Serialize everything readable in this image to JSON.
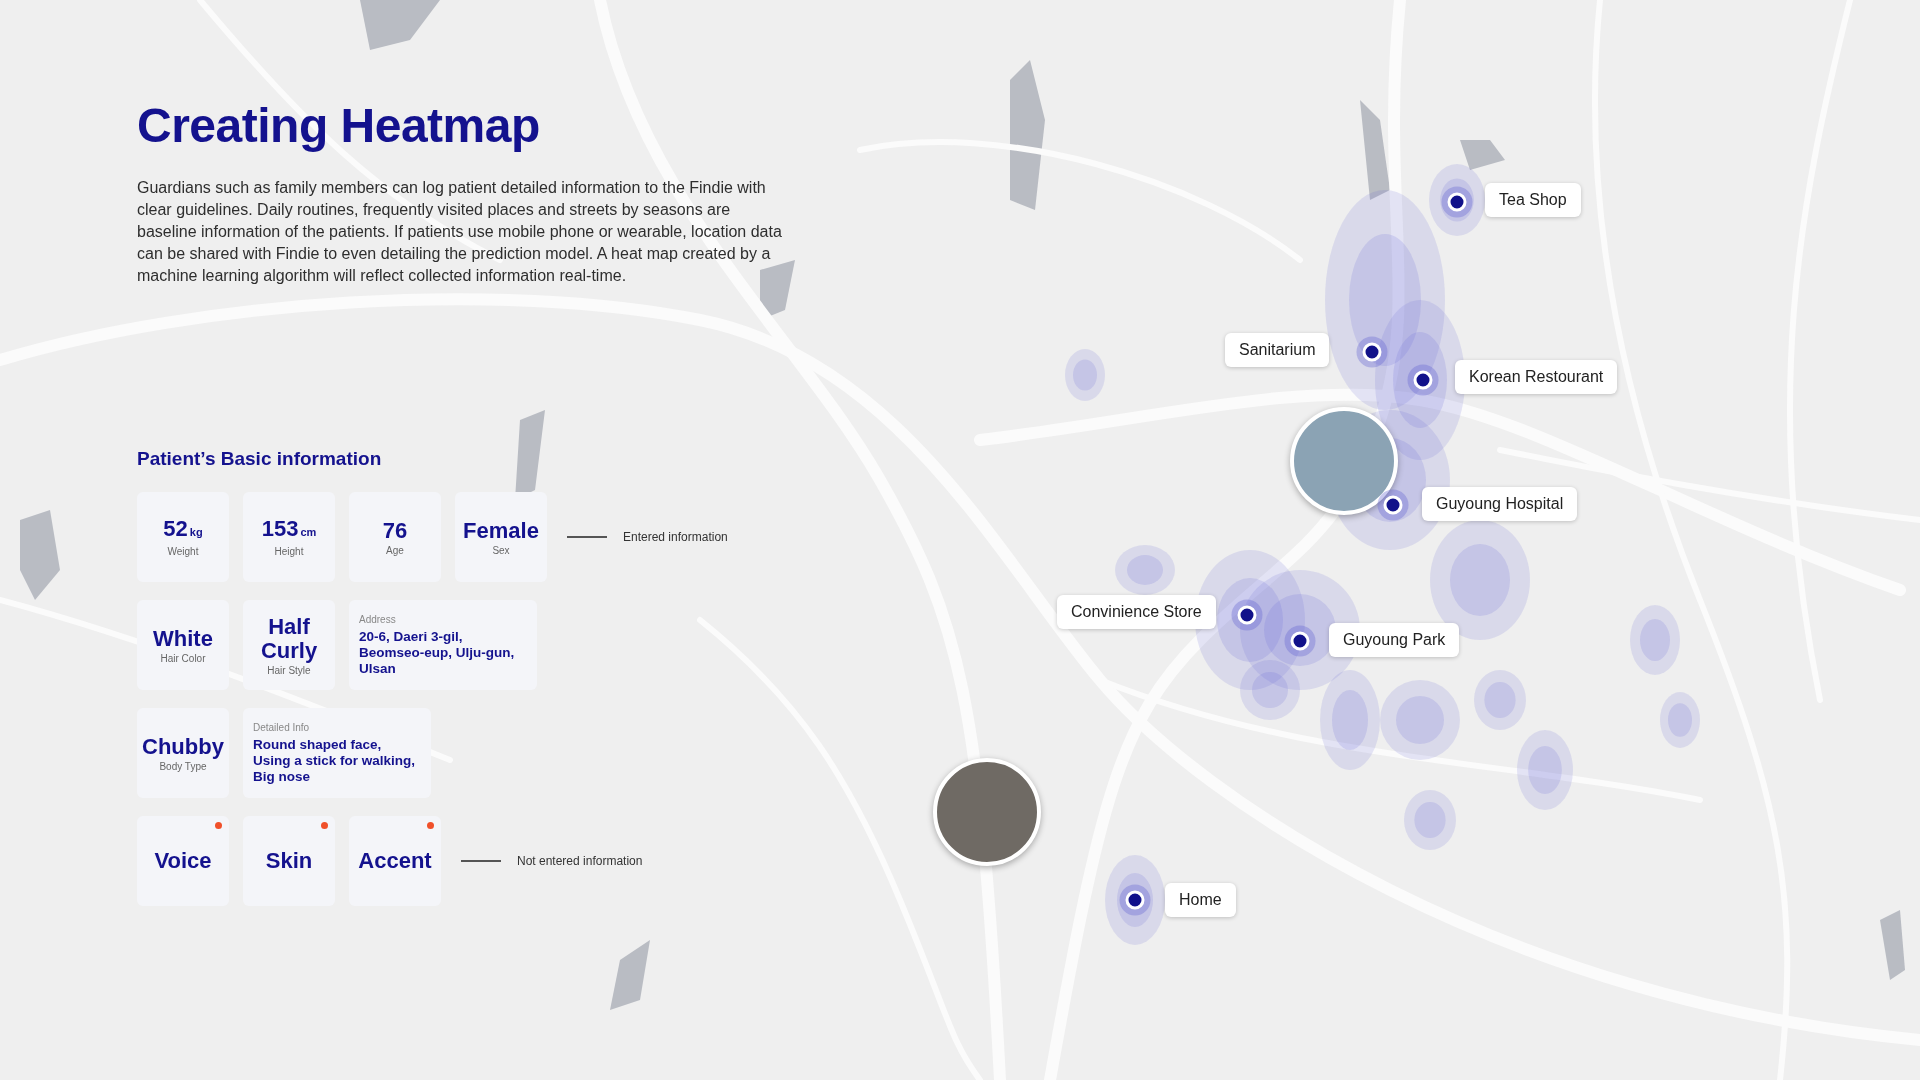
{
  "title": "Creating Heatmap",
  "description": "Guardians such as family members can log patient detailed information to the Findie with clear guidelines. Daily routines, frequently visited places and streets by seasons are baseline information of the patients. If patients use mobile phone or wearable, location data can be shared with Findie to even detailing the prediction model. A heat map created by a machine learning algorithm will reflect collected information real-time.",
  "section_title": "Patient’s Basic information",
  "rows": [
    {
      "legend": "Entered information",
      "cards": [
        {
          "kind": "measure",
          "value": "52",
          "unit": "kg",
          "label": "Weight",
          "entered": true
        },
        {
          "kind": "measure",
          "value": "153",
          "unit": "cm",
          "label": "Height",
          "entered": true
        },
        {
          "kind": "measure",
          "value": "76",
          "label": "Age",
          "entered": true
        },
        {
          "kind": "measure",
          "value": "Female",
          "label": "Sex",
          "entered": true
        }
      ]
    },
    {
      "cards": [
        {
          "kind": "measure",
          "value": "White",
          "label": "Hair Color",
          "entered": true
        },
        {
          "kind": "measure",
          "value": "Half Curly",
          "label": "Hair Style",
          "entered": true
        },
        {
          "kind": "note",
          "label": "Address",
          "text": "20-6, Daeri 3-gil, Beomseo-eup, Ulju-gun, Ulsan",
          "entered": true
        }
      ]
    },
    {
      "cards": [
        {
          "kind": "measure",
          "value": "Chubby",
          "label": "Body Type",
          "entered": true
        },
        {
          "kind": "note",
          "label": "Detailed Info",
          "text": "Round shaped face, Using a stick for walking, Big nose",
          "entered": true
        }
      ]
    },
    {
      "legend": "Not entered information",
      "cards": [
        {
          "kind": "measure",
          "value": "Voice",
          "entered": false
        },
        {
          "kind": "measure",
          "value": "Skin",
          "entered": false
        },
        {
          "kind": "measure",
          "value": "Accent",
          "entered": false
        }
      ]
    }
  ],
  "map": {
    "places": [
      {
        "name": "Tea Shop"
      },
      {
        "name": "Sanitarium"
      },
      {
        "name": "Korean Restourant"
      },
      {
        "name": "Guyoung Hospital"
      },
      {
        "name": "Convinience Store"
      },
      {
        "name": "Guyoung Park"
      },
      {
        "name": "Home"
      }
    ]
  }
}
